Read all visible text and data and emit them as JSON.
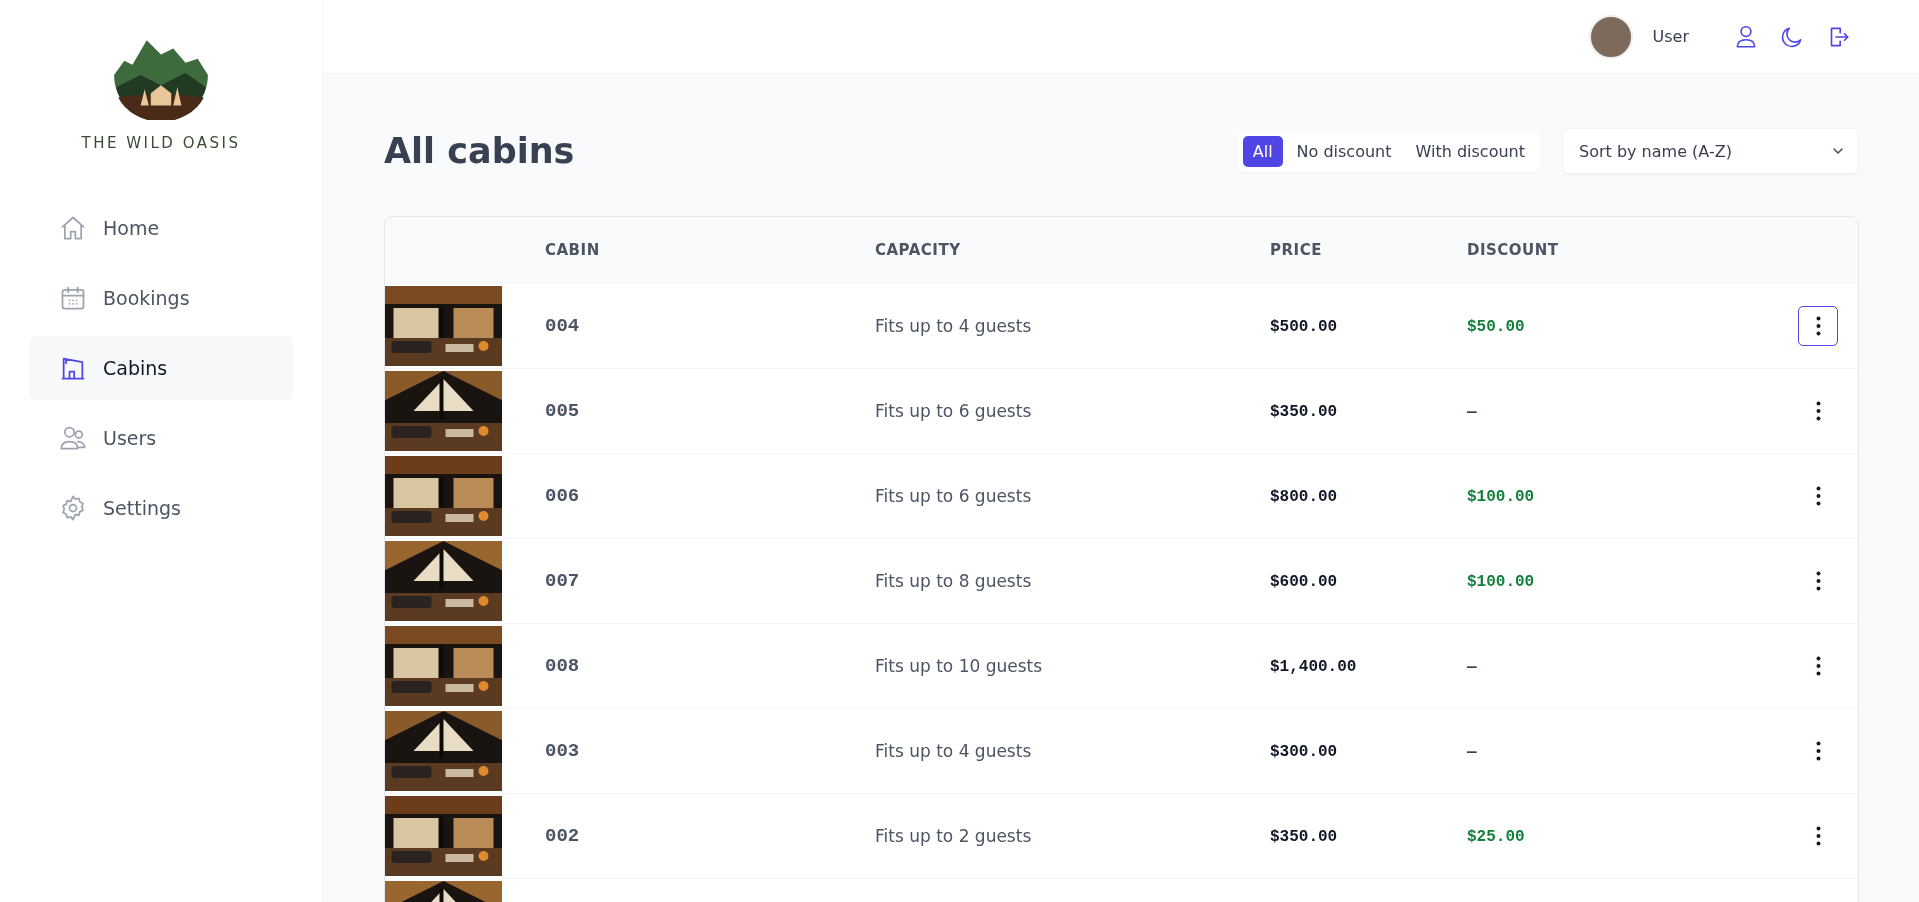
{
  "sidebar": {
    "brand": "THE WILD OASIS",
    "items": [
      {
        "label": "Home",
        "selected": false
      },
      {
        "label": "Bookings",
        "selected": false
      },
      {
        "label": "Cabins",
        "selected": true
      },
      {
        "label": "Users",
        "selected": false
      },
      {
        "label": "Settings",
        "selected": false
      }
    ]
  },
  "header": {
    "user_name": "User"
  },
  "page": {
    "title": "All cabins",
    "filters": [
      {
        "label": "All",
        "selected": true
      },
      {
        "label": "No discount",
        "selected": false
      },
      {
        "label": "With discount",
        "selected": false
      }
    ],
    "sort": {
      "value": "Sort by name (A-Z)"
    }
  },
  "table": {
    "columns": [
      "CABIN",
      "CAPACITY",
      "PRICE",
      "DISCOUNT"
    ],
    "rows": [
      {
        "image": {
          "kind": "picture"
        },
        "cabin": "004",
        "capacity": "Fits up to 4 guests",
        "price": "$500.00",
        "discount": "$50.00",
        "menu_selected": true
      },
      {
        "image": {
          "kind": "picture"
        },
        "cabin": "005",
        "capacity": "Fits up to 6 guests",
        "price": "$350.00",
        "discount": "—",
        "menu_selected": false
      },
      {
        "image": {
          "kind": "picture"
        },
        "cabin": "006",
        "capacity": "Fits up to 6 guests",
        "price": "$800.00",
        "discount": "$100.00",
        "menu_selected": false
      },
      {
        "image": {
          "kind": "picture"
        },
        "cabin": "007",
        "capacity": "Fits up to 8 guests",
        "price": "$600.00",
        "discount": "$100.00",
        "menu_selected": false
      },
      {
        "image": {
          "kind": "picture"
        },
        "cabin": "008",
        "capacity": "Fits up to 10 guests",
        "price": "$1,400.00",
        "discount": "—",
        "menu_selected": false
      },
      {
        "image": {
          "kind": "picture"
        },
        "cabin": "003",
        "capacity": "Fits up to 4 guests",
        "price": "$300.00",
        "discount": "—",
        "menu_selected": false
      },
      {
        "image": {
          "kind": "picture"
        },
        "cabin": "002",
        "capacity": "Fits up to 2 guests",
        "price": "$350.00",
        "discount": "$25.00",
        "menu_selected": false
      },
      {
        "image": {
          "kind": "picture"
        }
      }
    ]
  }
}
